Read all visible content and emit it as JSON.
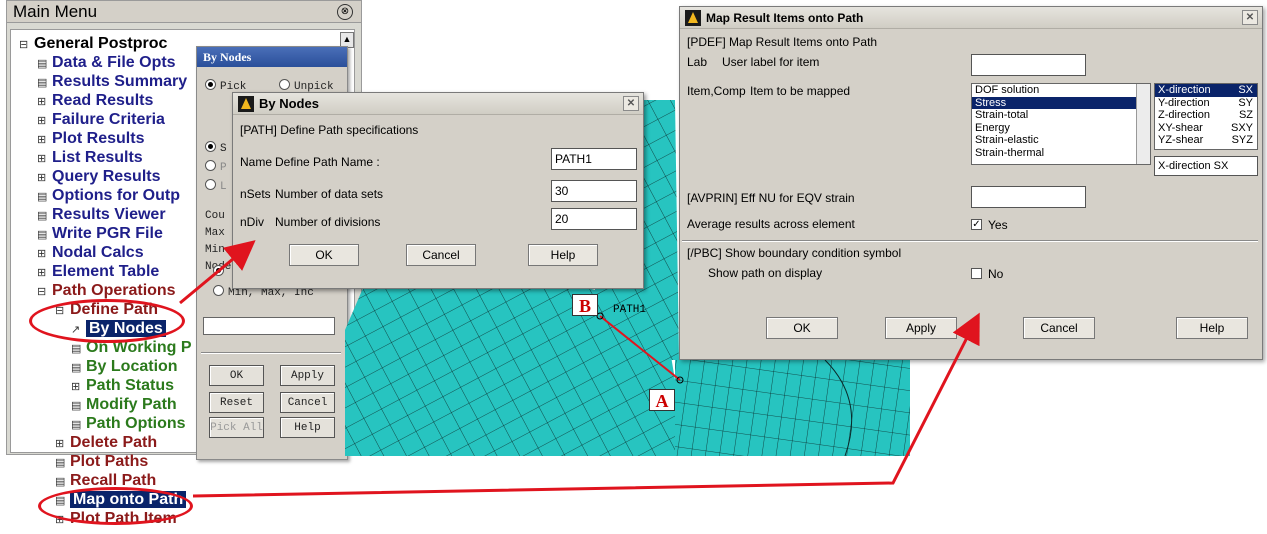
{
  "main_menu": {
    "title": "Main Menu",
    "collapse_glyph": "⊗",
    "items": [
      {
        "label": "General Postproc",
        "marker": "⊟",
        "color": "#000000",
        "level": 0
      },
      {
        "label": "Data & File Opts",
        "marker": "▤",
        "color": "#1f1f8a",
        "level": 1
      },
      {
        "label": "Results Summary",
        "marker": "▤",
        "color": "#1f1f8a",
        "level": 1
      },
      {
        "label": "Read Results",
        "marker": "⊞",
        "color": "#1f1f8a",
        "level": 1
      },
      {
        "label": "Failure Criteria",
        "marker": "⊞",
        "color": "#1f1f8a",
        "level": 1
      },
      {
        "label": "Plot Results",
        "marker": "⊞",
        "color": "#1f1f8a",
        "level": 1
      },
      {
        "label": "List Results",
        "marker": "⊞",
        "color": "#1f1f8a",
        "level": 1
      },
      {
        "label": "Query Results",
        "marker": "⊞",
        "color": "#1f1f8a",
        "level": 1
      },
      {
        "label": "Options for Outp",
        "marker": "▤",
        "color": "#1f1f8a",
        "level": 1
      },
      {
        "label": "Results Viewer",
        "marker": "▤",
        "color": "#1f1f8a",
        "level": 1
      },
      {
        "label": "Write PGR File",
        "marker": "▤",
        "color": "#1f1f8a",
        "level": 1
      },
      {
        "label": "Nodal Calcs",
        "marker": "⊞",
        "color": "#1f1f8a",
        "level": 1
      },
      {
        "label": "Element Table",
        "marker": "⊞",
        "color": "#1f1f8a",
        "level": 1
      },
      {
        "label": "Path Operations",
        "marker": "⊟",
        "color": "#8b1a1a",
        "level": 1
      },
      {
        "label": "Define Path",
        "marker": "⊟",
        "color": "#8b1a1a",
        "level": 2
      },
      {
        "label": "By Nodes",
        "marker": "↗",
        "color": "#ffffff",
        "level": 3,
        "selected": true
      },
      {
        "label": "On Working P",
        "marker": "▤",
        "color": "#2b7a1c",
        "level": 3
      },
      {
        "label": "By Location",
        "marker": "▤",
        "color": "#2b7a1c",
        "level": 3
      },
      {
        "label": "Path Status",
        "marker": "⊞",
        "color": "#2b7a1c",
        "level": 3
      },
      {
        "label": "Modify Path",
        "marker": "▤",
        "color": "#2b7a1c",
        "level": 3
      },
      {
        "label": "Path Options",
        "marker": "▤",
        "color": "#2b7a1c",
        "level": 3
      },
      {
        "label": "Delete Path",
        "marker": "⊞",
        "color": "#8b1a1a",
        "level": 2
      },
      {
        "label": "Plot Paths",
        "marker": "▤",
        "color": "#8b1a1a",
        "level": 2
      },
      {
        "label": "Recall Path",
        "marker": "▤",
        "color": "#8b1a1a",
        "level": 2
      },
      {
        "label": "Map onto Path",
        "marker": "▤",
        "color": "#ffffff",
        "level": 2,
        "selected": true
      },
      {
        "label": "Plot Path Item",
        "marker": "⊞",
        "color": "#8b1a1a",
        "level": 2
      }
    ]
  },
  "picker": {
    "title": "By Nodes",
    "pick_label": "Pick",
    "unpick_label": "Unpick",
    "side_labels": [
      "S",
      "P",
      "L"
    ],
    "info_labels": [
      "Cou",
      "Max",
      "Min",
      "Node"
    ],
    "minmax_label": "Min, Max, Inc",
    "buttons": {
      "ok": "OK",
      "apply": "Apply",
      "reset": "Reset",
      "cancel": "Cancel",
      "pick_all": "Pick All",
      "help": "Help"
    }
  },
  "define_path": {
    "title": "By Nodes",
    "header": "[PATH]  Define Path specifications",
    "rows": [
      {
        "key": "Name",
        "label": "Define Path Name :",
        "value": "PATH1"
      },
      {
        "key": "nSets",
        "label": "Number of data sets",
        "value": "30"
      },
      {
        "key": "nDiv",
        "label": "Number of divisions",
        "value": "20"
      }
    ],
    "buttons": {
      "ok": "OK",
      "cancel": "Cancel",
      "help": "Help"
    },
    "close_glyph": "✕"
  },
  "map_dialog": {
    "title": "Map Result Items onto Path",
    "header": "[PDEF]  Map Result Items onto Path",
    "lab_key": "Lab",
    "lab_label": "User label for item",
    "lab_value": "",
    "item_key": "Item,Comp",
    "item_label": "Item to be mapped",
    "item_list": [
      "DOF solution",
      "Stress",
      "Strain-total",
      "Energy",
      "Strain-elastic",
      "Strain-thermal"
    ],
    "item_selected": "Stress",
    "comp_list": [
      {
        "name": "X-direction",
        "code": "SX"
      },
      {
        "name": "Y-direction",
        "code": "SY"
      },
      {
        "name": "Z-direction",
        "code": "SZ"
      },
      {
        "name": "XY-shear",
        "code": "SXY"
      },
      {
        "name": "YZ-shear",
        "code": "SYZ"
      }
    ],
    "comp_selected": "X-direction   SX",
    "comp_value": "X-direction   SX",
    "avprin_label": "[AVPRIN]  Eff NU for EQV strain",
    "avprin_value": "",
    "avg_label": "Average results across element",
    "avg_value": "Yes",
    "avg_checked": true,
    "pbc_label": "[/PBC]  Show boundary condition symbol",
    "show_path_label": "Show path on display",
    "show_path_value": "No",
    "show_path_checked": false,
    "buttons": {
      "ok": "OK",
      "apply": "Apply",
      "cancel": "Cancel",
      "help": "Help"
    },
    "close_glyph": "✕"
  },
  "annotations": {
    "label_a": "A",
    "label_b": "B",
    "path_label": "PATH1",
    "arrow_color": "#e0141e"
  },
  "colors": {
    "mesh_fill": "#27c4c0",
    "mesh_line": "#0a2a2a",
    "selection": "#0a246a",
    "dialog_bg": "#d4d0c8"
  }
}
